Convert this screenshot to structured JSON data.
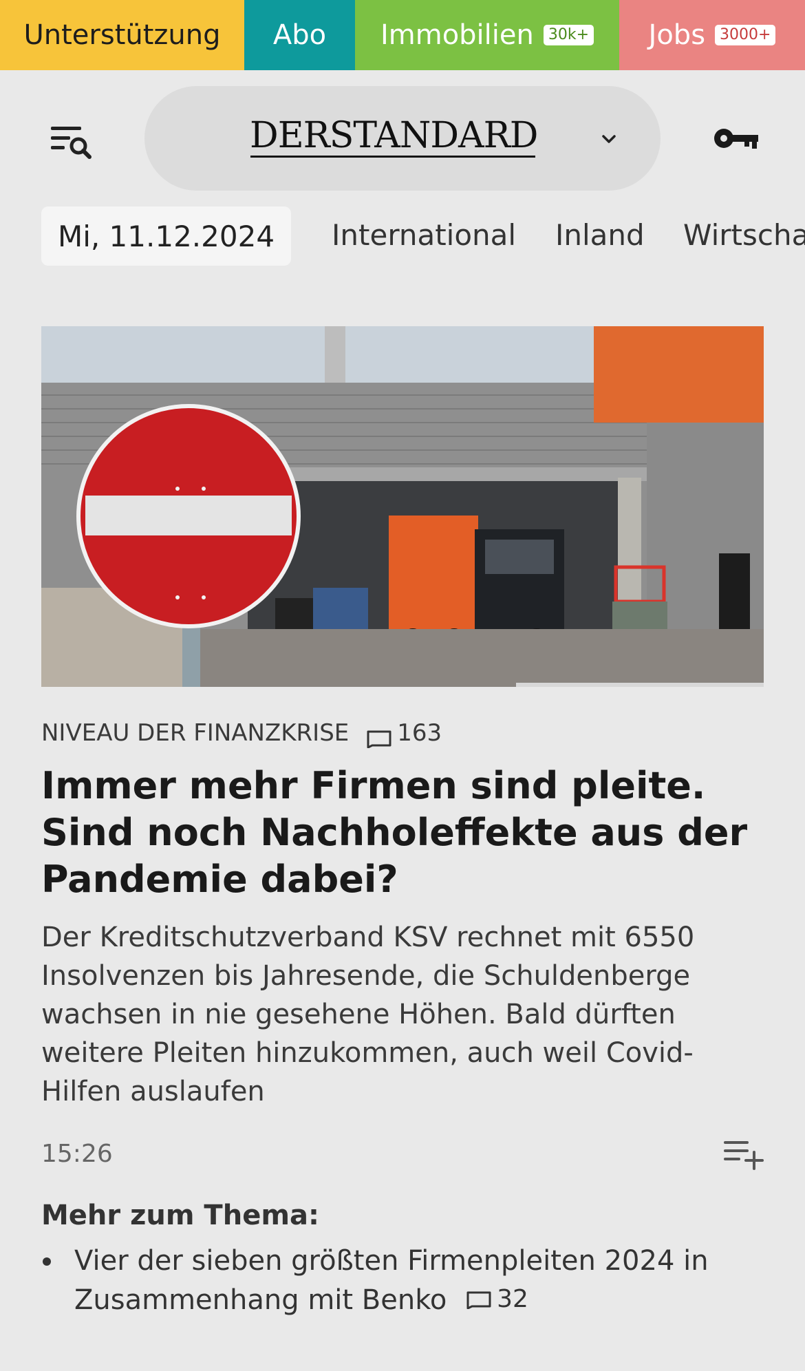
{
  "topbar": {
    "support_label": "Unterstützung",
    "abo_label": "Abo",
    "immobilien_label": "Immobilien",
    "immobilien_badge": "30k+",
    "jobs_label": "Jobs",
    "jobs_badge": "3000+"
  },
  "header": {
    "brand": "DERSTANDARD"
  },
  "date": "Mi, 11.12.2024",
  "nav": {
    "items": [
      "International",
      "Inland",
      "Wirtscha"
    ]
  },
  "article": {
    "kicker": "NIVEAU DER FINANZKRISE",
    "comments": "163",
    "headline": "Immer mehr Firmen sind pleite. Sind noch Nachholeffekte aus der Pandemie dabei?",
    "teaser": "Der Kreditschutzverband KSV rechnet mit 6550 Insolvenzen bis Jahresende, die Schuldenberge wachsen in nie gesehene Höhen. Bald dürften weitere Pleiten hinzukommen, auch weil Covid-Hilfen auslaufen",
    "time": "15:26"
  },
  "more": {
    "title": "Mehr zum Thema:",
    "items": [
      {
        "text": "Vier der sieben größten Firmenpleiten 2024 in Zusammenhang mit Benko",
        "comments": "32"
      }
    ]
  },
  "colors": {
    "support": "#f7c43a",
    "abo": "#0e9a9c",
    "immobilien": "#7cc143",
    "jobs": "#ea8482",
    "background": "#e9e9e9"
  }
}
